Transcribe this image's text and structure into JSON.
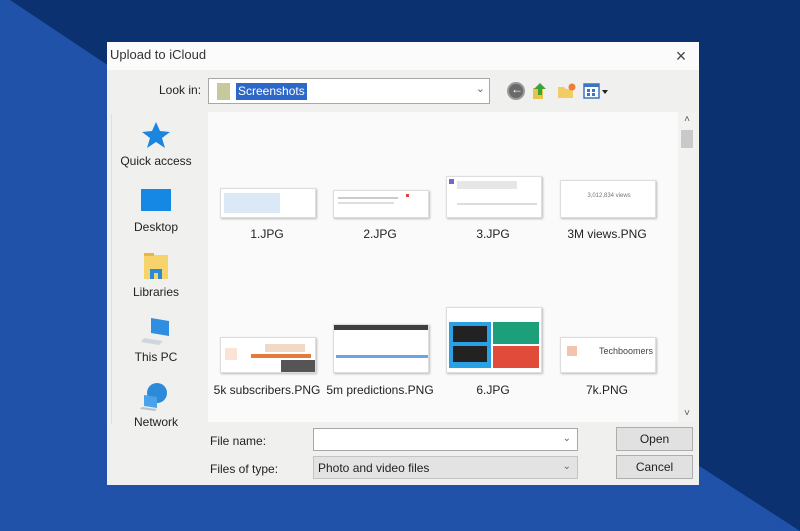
{
  "dialog": {
    "title": "Upload to iCloud",
    "close_icon": "×"
  },
  "lookin": {
    "label": "Look in:",
    "value": "Screenshots",
    "arrow": "⌄"
  },
  "toolbar": {
    "icons": [
      "back-icon",
      "up-one-level-icon",
      "new-folder-icon",
      "view-menu-icon"
    ]
  },
  "places": [
    {
      "label": "Quick access",
      "icon": "star-icon"
    },
    {
      "label": "Desktop",
      "icon": "desktop-icon"
    },
    {
      "label": "Libraries",
      "icon": "libraries-icon"
    },
    {
      "label": "This PC",
      "icon": "computer-icon"
    },
    {
      "label": "Network",
      "icon": "network-icon"
    }
  ],
  "files": [
    {
      "name": "1.JPG",
      "thumb_text": ""
    },
    {
      "name": "2.JPG",
      "thumb_text": ""
    },
    {
      "name": "3.JPG",
      "thumb_text": ""
    },
    {
      "name": "3M views.PNG",
      "thumb_text": "3,012,834 views"
    },
    {
      "name": "5k subscribers.PNG",
      "thumb_text": ""
    },
    {
      "name": "5m predictions.PNG",
      "thumb_text": ""
    },
    {
      "name": "6.JPG",
      "thumb_text": ""
    },
    {
      "name": "7k.PNG",
      "thumb_text": "Techboomers"
    }
  ],
  "scrollbar": {
    "up": "˄",
    "down": "˅"
  },
  "filename": {
    "label": "File name:",
    "value": "",
    "arrow": "⌄"
  },
  "filetype": {
    "label": "Files of type:",
    "value": "Photo and video files",
    "arrow": "⌄"
  },
  "buttons": {
    "open": "Open",
    "cancel": "Cancel"
  }
}
